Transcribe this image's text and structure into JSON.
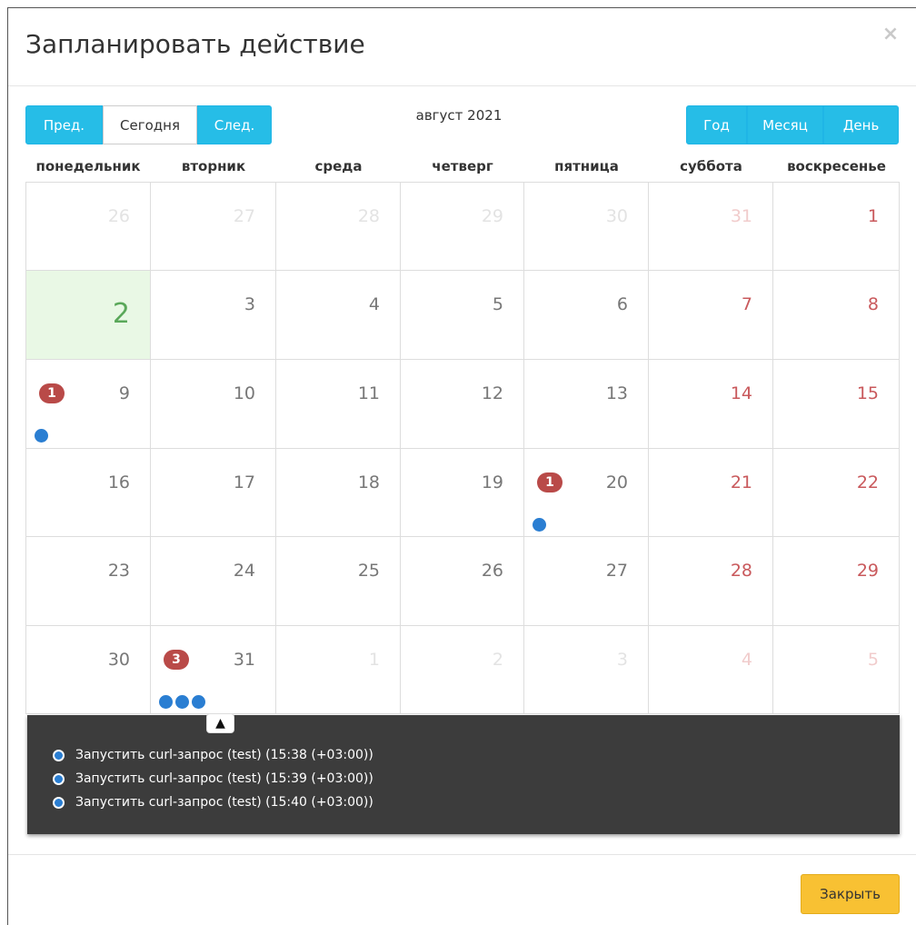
{
  "modal": {
    "title": "Запланировать действие",
    "close_icon": "×"
  },
  "nav": {
    "prev": "Пред.",
    "today": "Сегодня",
    "next": "След."
  },
  "calendar_title": "август 2021",
  "views": {
    "year": "Год",
    "month": "Месяц",
    "day": "День"
  },
  "weekdays": [
    "понедельник",
    "вторник",
    "среда",
    "четверг",
    "пятница",
    "суббота",
    "воскресенье"
  ],
  "weeks": [
    [
      {
        "day": "26",
        "kind": "other"
      },
      {
        "day": "27",
        "kind": "other"
      },
      {
        "day": "28",
        "kind": "other"
      },
      {
        "day": "29",
        "kind": "other"
      },
      {
        "day": "30",
        "kind": "other"
      },
      {
        "day": "31",
        "kind": "other"
      },
      {
        "day": "1",
        "kind": "weekend"
      }
    ],
    [
      {
        "day": "2",
        "kind": "today"
      },
      {
        "day": "3",
        "kind": "normal"
      },
      {
        "day": "4",
        "kind": "normal"
      },
      {
        "day": "5",
        "kind": "normal"
      },
      {
        "day": "6",
        "kind": "normal"
      },
      {
        "day": "7",
        "kind": "weekend"
      },
      {
        "day": "8",
        "kind": "weekend"
      }
    ],
    [
      {
        "day": "9",
        "kind": "normal",
        "badge": "1",
        "dots": 1
      },
      {
        "day": "10",
        "kind": "normal"
      },
      {
        "day": "11",
        "kind": "normal"
      },
      {
        "day": "12",
        "kind": "normal"
      },
      {
        "day": "13",
        "kind": "normal"
      },
      {
        "day": "14",
        "kind": "weekend"
      },
      {
        "day": "15",
        "kind": "weekend"
      }
    ],
    [
      {
        "day": "16",
        "kind": "normal"
      },
      {
        "day": "17",
        "kind": "normal"
      },
      {
        "day": "18",
        "kind": "normal"
      },
      {
        "day": "19",
        "kind": "normal"
      },
      {
        "day": "20",
        "kind": "normal",
        "badge": "1",
        "dots": 1
      },
      {
        "day": "21",
        "kind": "weekend"
      },
      {
        "day": "22",
        "kind": "weekend"
      }
    ],
    [
      {
        "day": "23",
        "kind": "normal"
      },
      {
        "day": "24",
        "kind": "normal"
      },
      {
        "day": "25",
        "kind": "normal"
      },
      {
        "day": "26",
        "kind": "normal"
      },
      {
        "day": "27",
        "kind": "normal"
      },
      {
        "day": "28",
        "kind": "weekend"
      },
      {
        "day": "29",
        "kind": "weekend"
      }
    ],
    [
      {
        "day": "30",
        "kind": "normal"
      },
      {
        "day": "31",
        "kind": "normal",
        "badge": "3",
        "dots": 3
      },
      {
        "day": "1",
        "kind": "other"
      },
      {
        "day": "2",
        "kind": "other"
      },
      {
        "day": "3",
        "kind": "other"
      },
      {
        "day": "4",
        "kind": "other"
      },
      {
        "day": "5",
        "kind": "other"
      }
    ]
  ],
  "events_popover": {
    "caret_icon": "chevron-up-icon",
    "events": [
      "Запустить curl-запрос (test) (15:38 (+03:00))",
      "Запустить curl-запрос (test) (15:39 (+03:00))",
      "Запустить curl-запрос (test) (15:40 (+03:00))"
    ]
  },
  "footer": {
    "close_label": "Закрыть"
  },
  "colors": {
    "primary": "#26bde7",
    "warning": "#f8c133",
    "badge": "#b94a48",
    "event_dot": "#2a7ed2",
    "today_bg": "#e9f8e5",
    "weekend_text": "#c9595c"
  }
}
